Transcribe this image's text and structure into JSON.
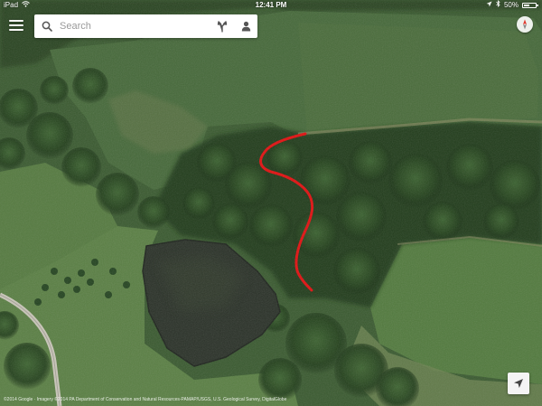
{
  "status_bar": {
    "device": "iPad",
    "time": "12:41 PM",
    "battery": "50%",
    "battery_level": 0.5
  },
  "search": {
    "placeholder": "Search"
  },
  "icons": {
    "menu": "hamburger-menu-icon",
    "search": "search-icon",
    "directions": "directions-icon",
    "account": "person-icon",
    "compass": "compass-icon",
    "locate": "my-location-icon"
  },
  "colors": {
    "route": "#e01010",
    "water": "#2b3229",
    "field": "#3f6233",
    "forest": "#25401f"
  },
  "attribution": "©2014 Google · Imagery ©2014 PA Department of Conservation and Natural Resources-PAMAP/USGS, U.S. Geological Survey, DigitalGlobe"
}
